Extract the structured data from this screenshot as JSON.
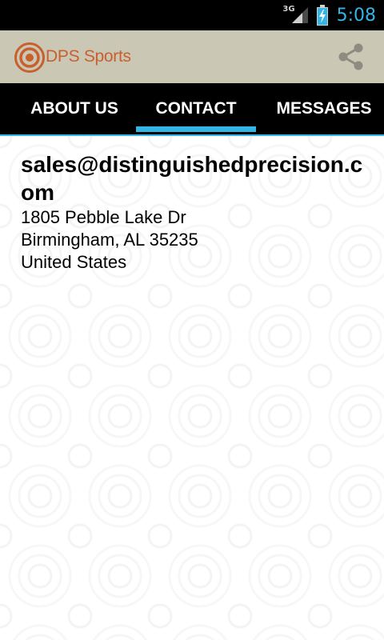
{
  "status_bar": {
    "network_type": "3G",
    "time": "5:08",
    "icons": [
      "signal-icon",
      "battery-charging-icon"
    ]
  },
  "action_bar": {
    "app_title": "DPS Sports",
    "logo_icon": "target-logo-icon",
    "share_icon": "share-icon"
  },
  "tabs": [
    {
      "label": "ABOUT US",
      "selected": false
    },
    {
      "label": "CONTACT",
      "selected": true
    },
    {
      "label": "MESSAGES",
      "selected": false
    }
  ],
  "contact": {
    "email": "sales@distinguishedprecision.com",
    "address": [
      "1805 Pebble Lake Dr",
      "Birmingham, AL 35235",
      "United States"
    ]
  },
  "colors": {
    "accent": "#33b5e5",
    "brand": "#c8602e",
    "action_bar": "#cbc7b5"
  }
}
